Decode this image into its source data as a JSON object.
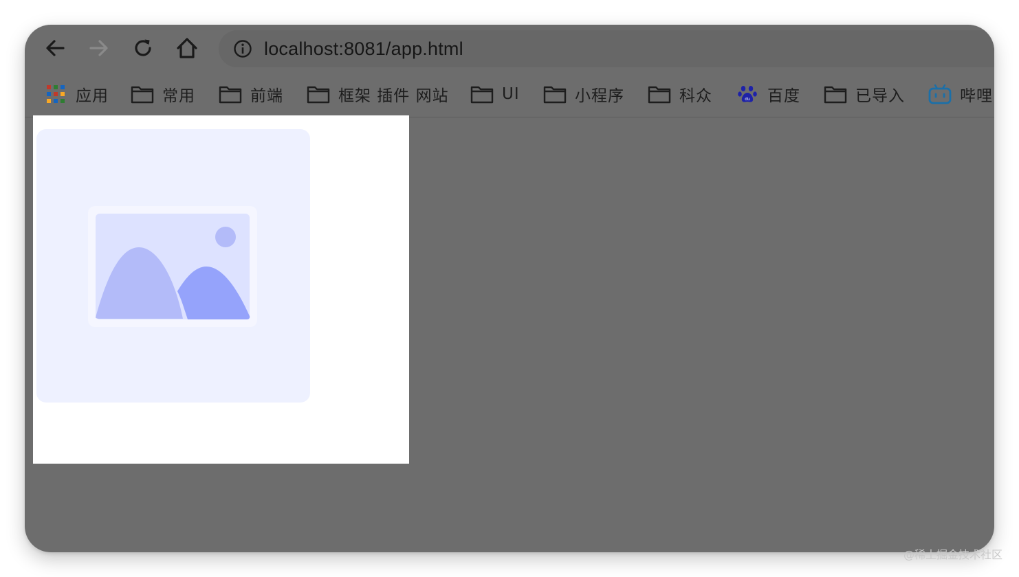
{
  "browser": {
    "url": "localhost:8081/app.html"
  },
  "bookmarks": [
    {
      "label": "应用",
      "icon": "apps-grid-icon"
    },
    {
      "label": "常用",
      "icon": "folder-icon"
    },
    {
      "label": "前端",
      "icon": "folder-icon"
    },
    {
      "label": "框架 插件 网站",
      "icon": "folder-icon"
    },
    {
      "label": "UI",
      "icon": "folder-icon"
    },
    {
      "label": "小程序",
      "icon": "folder-icon"
    },
    {
      "label": "科众",
      "icon": "folder-icon"
    },
    {
      "label": "百度",
      "icon": "baidu-paw-icon"
    },
    {
      "label": "已导入",
      "icon": "folder-icon"
    },
    {
      "label": "哔哩",
      "icon": "bilibili-tv-icon"
    }
  ],
  "content": {
    "image_placeholder_icon": "image-placeholder-icon"
  },
  "watermark": "@稀土掘金技术社区",
  "colors": {
    "window_bg": "#6d6d6d",
    "placeholder_bg": "#eef1ff",
    "mountain_light": "#b3bbf9",
    "mountain_dark": "#95a3fb",
    "sun": "#b3bbf9"
  }
}
